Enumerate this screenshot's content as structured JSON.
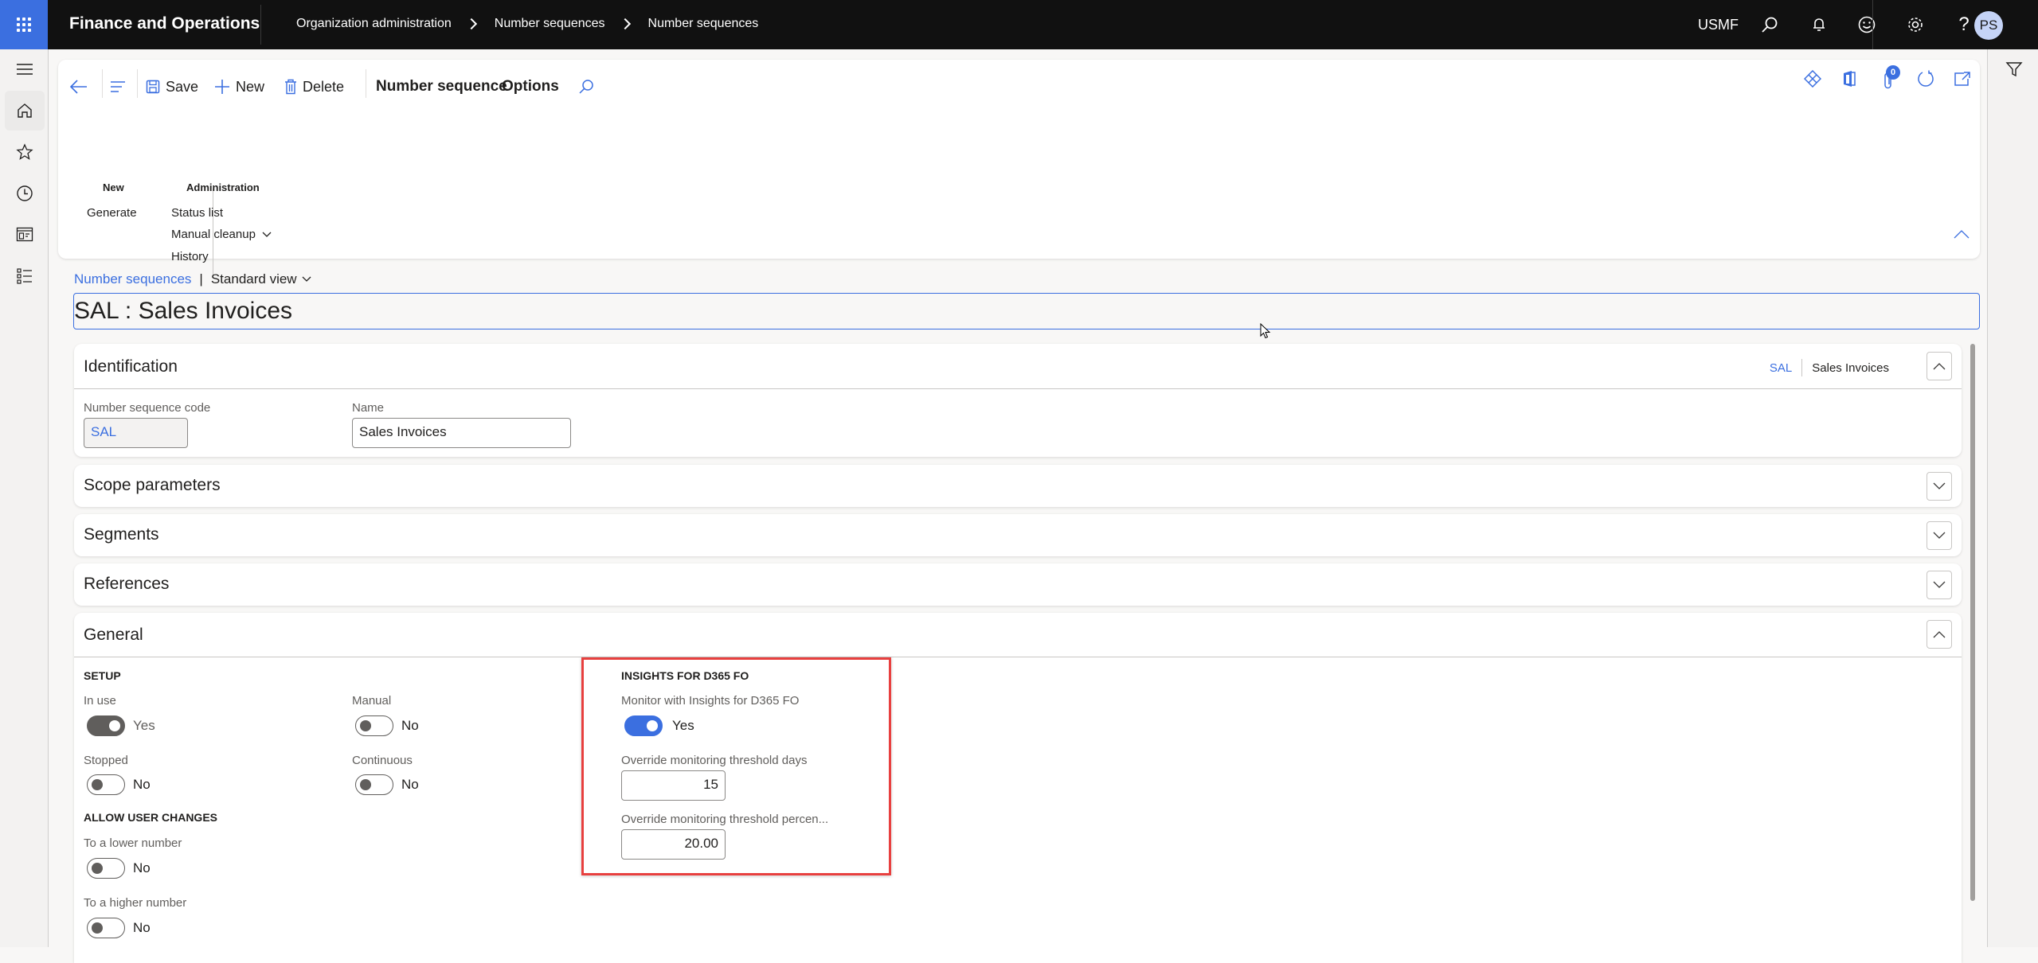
{
  "topnav": {
    "app_title": "Finance and Operations",
    "breadcrumb": [
      "Organization administration",
      "Number sequences",
      "Number sequences"
    ],
    "company": "USMF",
    "avatar_initials": "PS",
    "icons": [
      "search-icon",
      "bell-icon",
      "smiley-icon",
      "gear-icon",
      "help-icon"
    ]
  },
  "leftrail": {
    "items": [
      "hamburger-icon",
      "home-icon",
      "star-icon",
      "clock-icon",
      "workspace-icon",
      "list-icon"
    ]
  },
  "toolbar": {
    "back_label": "Back",
    "save_label": "Save",
    "new_label": "New",
    "delete_label": "Delete",
    "tabs": [
      {
        "label": "Number sequence",
        "active": true
      },
      {
        "label": "Options",
        "active": false
      }
    ],
    "attachments_count": "0",
    "groups": [
      {
        "title": "New",
        "items": [
          "Generate"
        ]
      },
      {
        "title": "Administration",
        "items": [
          "Status list",
          "Manual cleanup",
          "History"
        ]
      }
    ]
  },
  "page": {
    "crumb_link": "Number sequences",
    "crumb_sep": "|",
    "view_label": "Standard view",
    "title": "SAL : Sales Invoices"
  },
  "identification": {
    "title": "Identification",
    "summary_code": "SAL",
    "summary_name": "Sales Invoices",
    "code_label": "Number sequence code",
    "code_value": "SAL",
    "name_label": "Name",
    "name_value": "Sales Invoices"
  },
  "sections": {
    "scope": "Scope parameters",
    "segments": "Segments",
    "references": "References",
    "general": "General"
  },
  "general": {
    "setup_head": "SETUP",
    "in_use": {
      "label": "In use",
      "value": "Yes",
      "on": true
    },
    "manual": {
      "label": "Manual",
      "value": "No",
      "on": false
    },
    "stopped": {
      "label": "Stopped",
      "value": "No",
      "on": false
    },
    "continuous": {
      "label": "Continuous",
      "value": "No",
      "on": false
    },
    "allow_head": "ALLOW USER CHANGES",
    "lower": {
      "label": "To a lower number",
      "value": "No",
      "on": false
    },
    "higher": {
      "label": "To a higher number",
      "value": "No",
      "on": false
    },
    "insights_head": "INSIGHTS FOR D365 FO",
    "monitor": {
      "label": "Monitor with Insights for D365 FO",
      "value": "Yes",
      "on": true
    },
    "days_label": "Override monitoring threshold days",
    "days_value": "15",
    "percent_label": "Override monitoring threshold percen...",
    "percent_value": "20.00"
  },
  "colors": {
    "accent": "#3b6fe0",
    "highlight": "#e8403f",
    "nav_bg": "#111111"
  }
}
